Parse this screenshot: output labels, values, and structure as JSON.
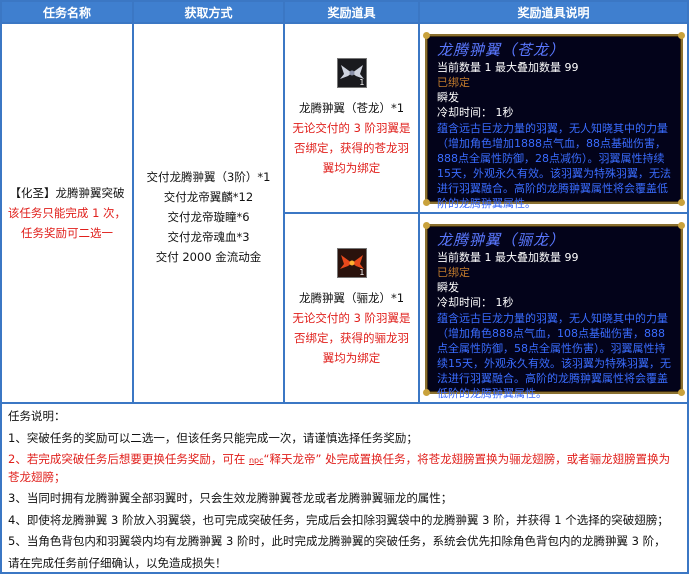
{
  "headers": {
    "task_name": "任务名称",
    "obtain_method": "获取方式",
    "reward_item": "奖励道具",
    "reward_desc": "奖励道具说明"
  },
  "task": {
    "name": "【化圣】龙腾翀翼突破",
    "limit": "该任务只能完成 1 次，",
    "choice": "任务奖励可二选一"
  },
  "obtain": [
    "交付龙腾翀翼（3阶）*1",
    "交付龙帝翼麟*12",
    "交付龙帝璇瞳*6",
    "交付龙帝魂血*3",
    "交付 2000 金流动金"
  ],
  "rewards": [
    {
      "icon": "silver-wing-icon",
      "name": "龙腾翀翼（苍龙）*1",
      "note_lines": [
        "无论交付的 3 阶羽翼是",
        "否绑定，获得的苍龙羽",
        "翼均为绑定"
      ],
      "tooltip": {
        "title": "龙腾翀翼（苍龙）",
        "count": "当前数量 1  最大叠加数量 99",
        "bound": "已绑定",
        "cast": "瞬发",
        "cooldown": "冷却时间：   1秒",
        "desc": "蕴含远古巨龙力量的羽翼，无人知晓其中的力量（增加角色增加1888点气血，88点基础伤害，888点全属性防御，28点减伤）。羽翼属性持续15天，外观永久有效。该羽翼为特殊羽翼，无法进行羽翼融合。高阶的龙腾翀翼属性将会覆盖低阶的龙腾翀翼属性。"
      }
    },
    {
      "icon": "red-wing-icon",
      "name": "龙腾翀翼（骊龙）*1",
      "note_lines": [
        "无论交付的 3 阶羽翼是",
        "否绑定，获得的骊龙羽",
        "翼均为绑定"
      ],
      "tooltip": {
        "title": "龙腾翀翼（骊龙）",
        "count": "当前数量 1  最大叠加数量 99",
        "bound": "已绑定",
        "cast": "瞬发",
        "cooldown": "冷却时间：   1秒",
        "desc": "蕴含远古巨龙力量的羽翼，无人知晓其中的力量（增加角色888点气血，108点基础伤害，888点全属性防御，58点全属性伤害）。羽翼属性持续15天，外观永久有效。该羽翼为特殊羽翼，无法进行羽翼融合。高阶的龙腾翀翼属性将会覆盖低阶的龙腾翀翼属性。"
      }
    }
  ],
  "notes": {
    "title": "任务说明：",
    "n1": "1、突破任务的奖励可以二选一，但该任务只能完成一次，请谨慎选择任务奖励；",
    "n2_pre": "2、若完成突破任务后想要更换任务奖励，可在 ",
    "n2_npc_tag": "npc",
    "n2_post": "“释天龙帝” 处完成置换任务，将苍龙翅膀置换为骊龙翅膀，或者骊龙翅膀置换为苍龙翅膀；",
    "n3": "3、当同时拥有龙腾翀翼全部羽翼时，只会生效龙腾翀翼苍龙或者龙腾翀翼骊龙的属性；",
    "n4": "4、即使将龙腾翀翼 3 阶放入羽翼袋，也可完成突破任务，完成后会扣除羽翼袋中的龙腾翀翼 3 阶，并获得 1 个选择的突破翅膀；",
    "n5a": "5、当角色背包内和羽翼袋内均有龙腾翀翼 3 阶时，此时完成龙腾翀翼的突破任务，系统会优先扣除角色背包内的龙腾翀翼 3 阶，",
    "n5b": "请在完成任务前仔细确认，以免造成损失！"
  }
}
